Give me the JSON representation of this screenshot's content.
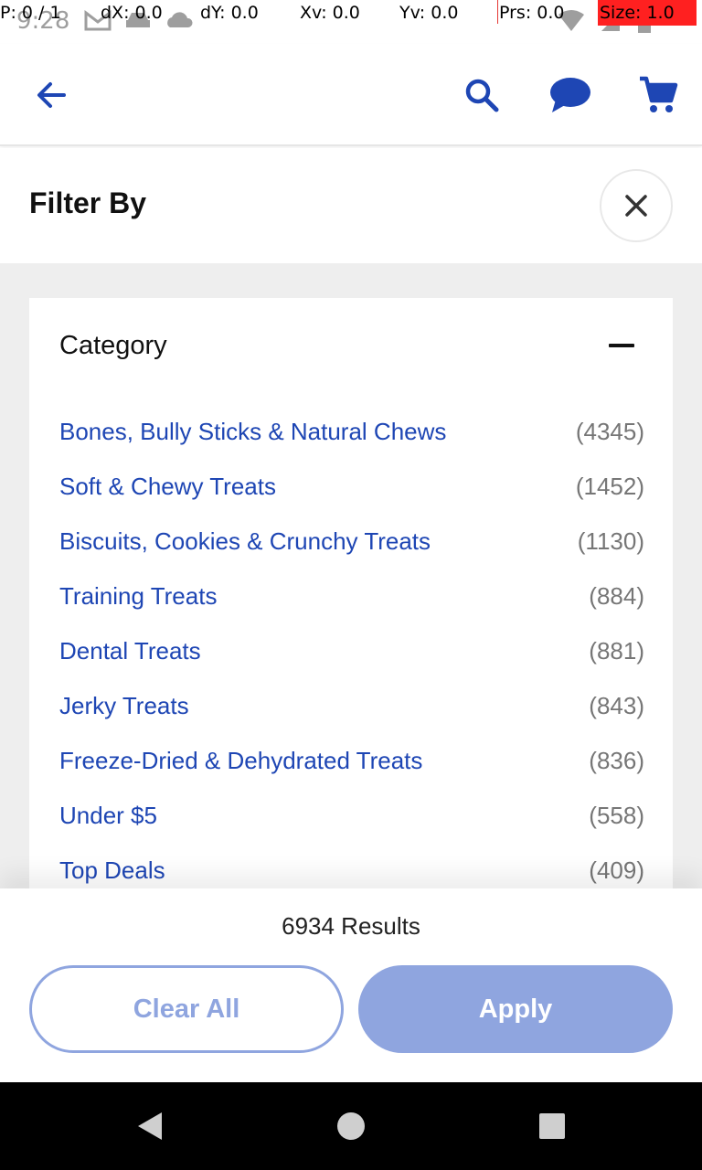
{
  "status_bar": {
    "clock": "9:28",
    "overlay": {
      "pointer": "P: 0 / 1",
      "dx": "dX: 0.0",
      "dy": "dY: 0.0",
      "xv": "Xv: 0.0",
      "yv": "Yv: 0.0",
      "prs": "Prs: 0.0",
      "size": "Size: 1.0"
    },
    "icons": [
      "gmail-icon",
      "car-icon",
      "cloud-icon",
      "wifi-icon",
      "signal-icon",
      "battery-icon"
    ]
  },
  "app_bar": {
    "icons": [
      "back-arrow-icon",
      "search-icon",
      "chat-icon",
      "cart-icon"
    ],
    "accent": "#1e46b4"
  },
  "filter": {
    "title": "Filter By",
    "category": {
      "title": "Category",
      "items": [
        {
          "label": "Bones, Bully Sticks & Natural Chews",
          "count": "(4345)"
        },
        {
          "label": "Soft & Chewy Treats",
          "count": "(1452)"
        },
        {
          "label": "Biscuits, Cookies & Crunchy Treats",
          "count": "(1130)"
        },
        {
          "label": "Training Treats",
          "count": "(884)"
        },
        {
          "label": "Dental Treats",
          "count": "(881)"
        },
        {
          "label": "Jerky Treats",
          "count": "(843)"
        },
        {
          "label": "Freeze-Dried & Dehydrated Treats",
          "count": "(836)"
        },
        {
          "label": "Under $5",
          "count": "(558)"
        },
        {
          "label": "Top Deals",
          "count": "(409)"
        }
      ]
    }
  },
  "bottom": {
    "results": "6934 Results",
    "clear_label": "Clear All",
    "apply_label": "Apply"
  },
  "nav_bar": {
    "icons": [
      "back-triangle-icon",
      "home-circle-icon",
      "recents-square-icon"
    ]
  }
}
